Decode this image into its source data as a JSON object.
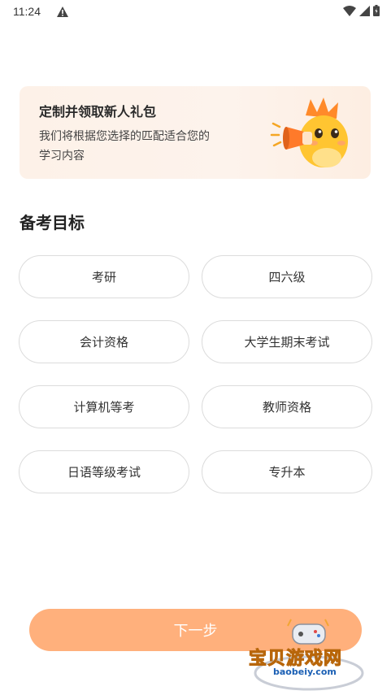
{
  "status_bar": {
    "time": "11:24"
  },
  "banner": {
    "title": "定制并领取新人礼包",
    "desc_line1": "我们将根据您选择的匹配适合您的",
    "desc_line2": "学习内容"
  },
  "section": {
    "title": "备考目标"
  },
  "options": [
    {
      "label": "考研"
    },
    {
      "label": "四六级"
    },
    {
      "label": "会计资格"
    },
    {
      "label": "大学生期末考试"
    },
    {
      "label": "计算机等考"
    },
    {
      "label": "教师资格"
    },
    {
      "label": "日语等级考试"
    },
    {
      "label": "专升本"
    }
  ],
  "next_button": {
    "label": "下一步"
  },
  "watermark": {
    "text": "宝贝游戏网",
    "url": "baobeiy.com"
  },
  "colors": {
    "accent": "#ffb07c",
    "banner_bg": "#fdf1e8",
    "option_border": "#dcdcdc"
  }
}
